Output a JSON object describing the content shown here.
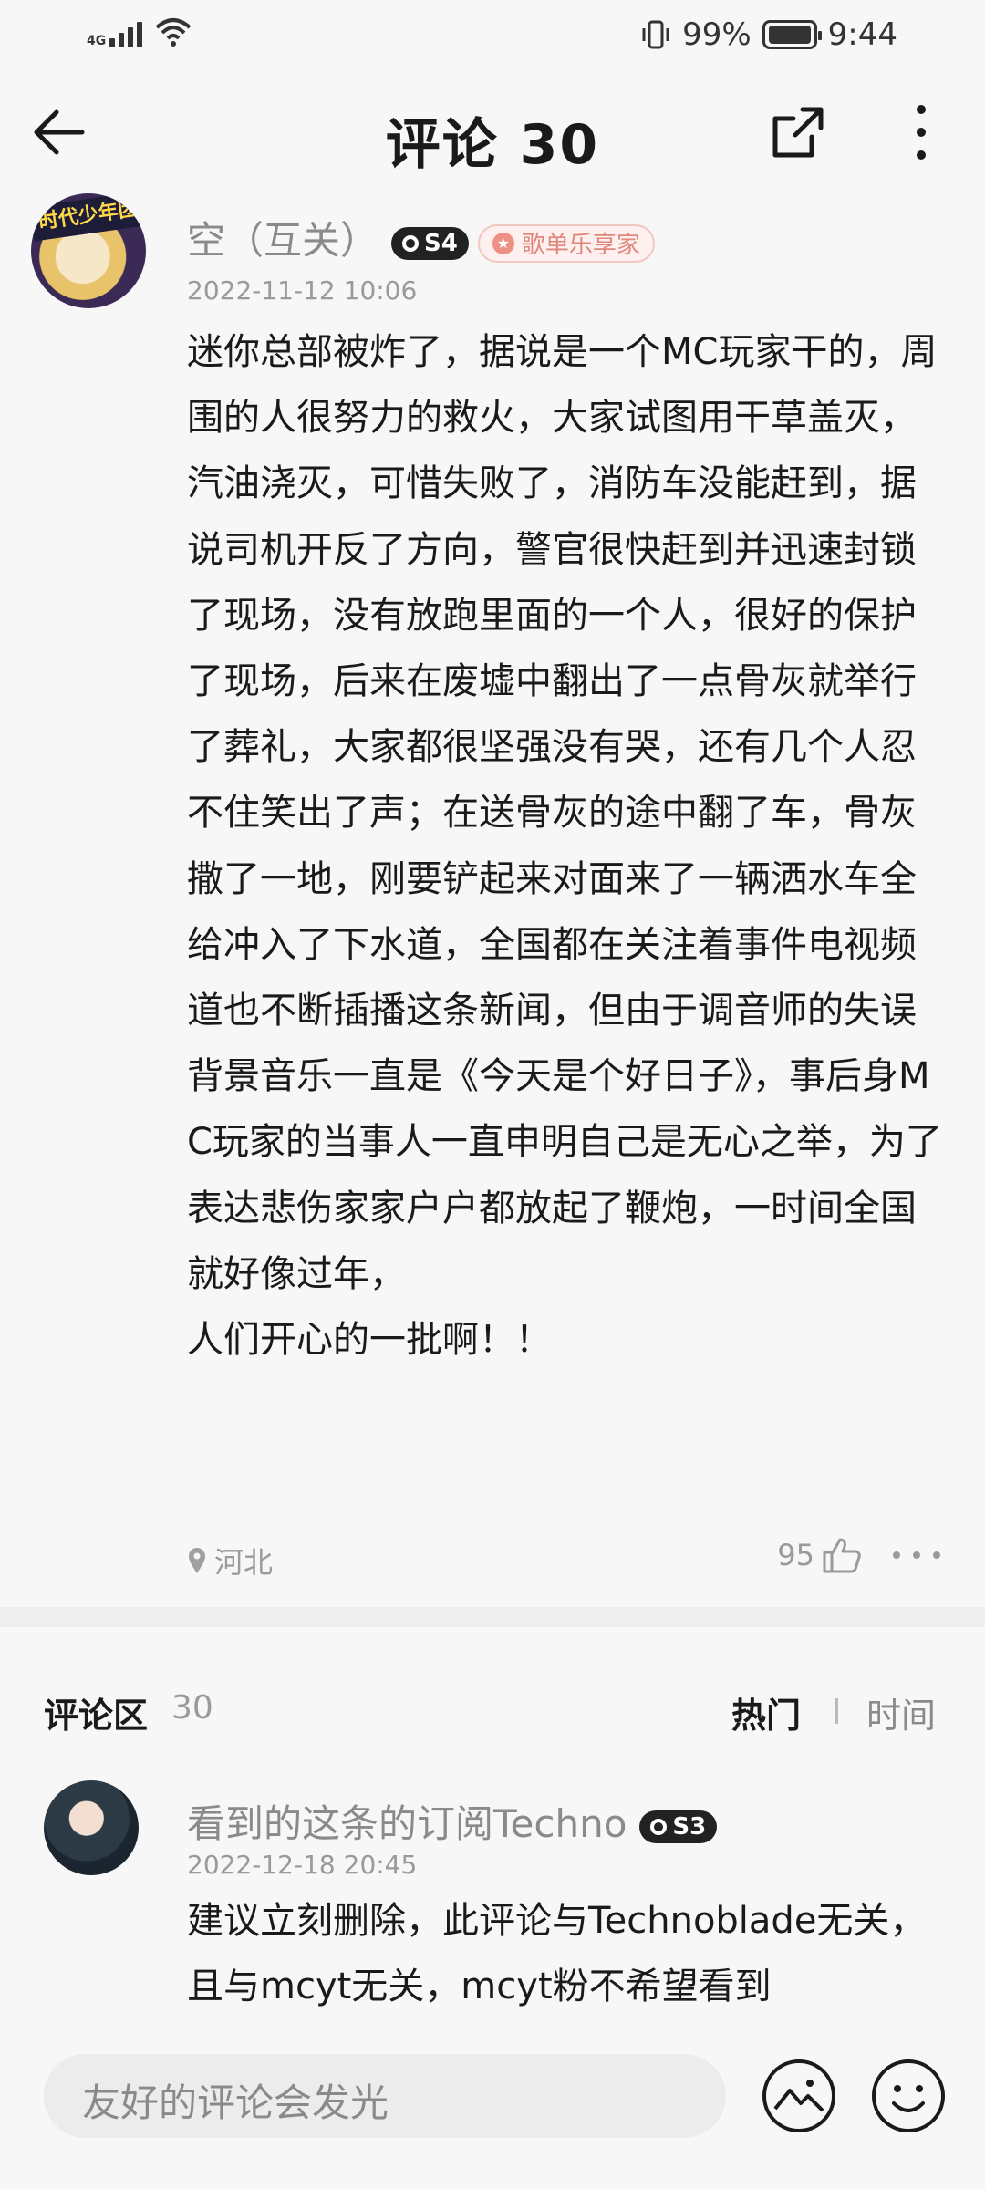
{
  "status_bar": {
    "network": "4G",
    "battery_percent": "99%",
    "time": "9:44",
    "icons": [
      "signal-icon",
      "wifi-icon",
      "vibrate-icon",
      "battery-icon"
    ]
  },
  "header": {
    "title": "评论 30",
    "back_icon": "back-arrow-icon",
    "share_icon": "share-icon",
    "more_icon": "more-vertical-icon"
  },
  "main_comment": {
    "username": "空（互关）",
    "level": "S4",
    "vip_badge": "歌单乐享家",
    "date": "2022-11-12 10:06",
    "text": "迷你总部被炸了，据说是一个MC玩家干的，周围的人很努力的救火，大家试图用干草盖灭，汽油浇灭，可惜失败了，消防车没能赶到，据说司机开反了方向，警官很快赶到并迅速封锁了现场，没有放跑里面的一个人，很好的保护了现场，后来在废墟中翻出了一点骨灰就举行了葬礼，大家都很坚强没有哭，还有几个人忍不住笑出了声；在送骨灰的途中翻了车，骨灰撒了一地，刚要铲起来对面来了一辆洒水车全给冲入了下水道，全国都在关注着事件电视频道也不断插播这条新闻，但由于调音师的失误背景音乐一直是《今天是个好日子》，事后身MC玩家的当事人一直申明自己是无心之举，为了表达悲伤家家户户都放起了鞭炮，一时间全国就好像过年，\n人们开心的一批啊！！",
    "location": "河北",
    "likes": "95",
    "avatar_badge_text": "时代少年团"
  },
  "comments_section": {
    "title": "评论区",
    "count": "30",
    "sort_hot": "热门",
    "sort_time": "时间"
  },
  "reply": {
    "username": "看到的这条的订阅Techno",
    "level": "S3",
    "date": "2022-12-18 20:45",
    "text": "建议立刻删除，此评论与Technoblade无关，且与mcyt无关，mcyt粉不希望看到"
  },
  "bottom_bar": {
    "input_placeholder": "友好的评论会发光",
    "image_icon": "image-icon",
    "emoji_icon": "emoji-icon"
  },
  "colors": {
    "background": "#f7f7f7",
    "text_primary": "#1a1a1a",
    "text_secondary": "#9a9a9a",
    "vip_accent": "#e0867b"
  }
}
